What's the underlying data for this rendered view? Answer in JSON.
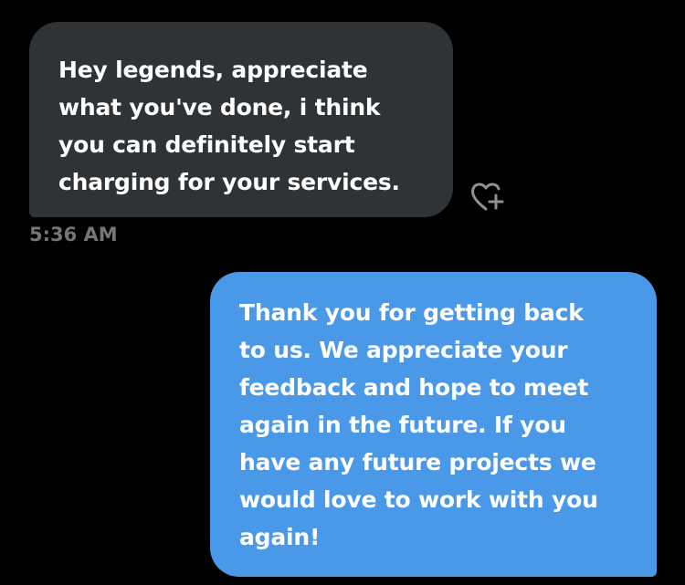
{
  "conversation": {
    "incoming_message": {
      "text": "Hey legends, appreciate\nwhat you've done, i think\nyou can definitely start\ncharging for your services.",
      "timestamp": "5:36 AM",
      "react_icon": "heart-plus-icon"
    },
    "outgoing_message": {
      "text": "Thank you for getting back\nto us. We appreciate your\nfeedback and hope to meet\nagain in the future. If you\nhave any future projects we\nwould love to work with you\nagain!"
    }
  },
  "colors": {
    "background": "#000000",
    "incoming_bubble": "#2f3336",
    "outgoing_bubble": "#4a99e9",
    "timestamp": "#71767b",
    "text": "#ffffff"
  }
}
